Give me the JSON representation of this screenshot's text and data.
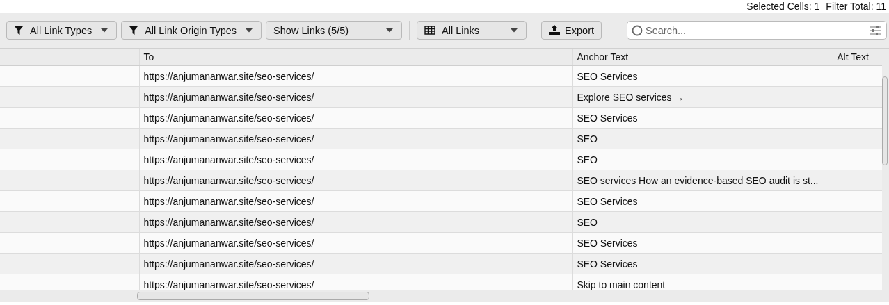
{
  "status_bar": {
    "selected_cells": "Selected Cells: 1",
    "filter_total": "Filter Total: 11"
  },
  "toolbar": {
    "dropdowns": [
      {
        "kind": "filter",
        "label": "All Link Types"
      },
      {
        "kind": "filter",
        "label": "All Link Origin Types"
      },
      {
        "kind": "plain",
        "label": "Show Links (5/5)"
      },
      {
        "kind": "view",
        "label": "All Links"
      }
    ],
    "export_button": "Export",
    "search": {
      "placeholder": "Search..."
    }
  },
  "table": {
    "columns": [
      "To",
      "Anchor Text",
      "Alt Text"
    ],
    "rows": [
      {
        "to": "https://anjumananwar.site/seo-services/",
        "anchor_text": "SEO Services"
      },
      {
        "to": "https://anjumananwar.site/seo-services/",
        "anchor_text": "Explore SEO services →"
      },
      {
        "to": "https://anjumananwar.site/seo-services/",
        "anchor_text": "SEO Services"
      },
      {
        "to": "https://anjumananwar.site/seo-services/",
        "anchor_text": "SEO"
      },
      {
        "to": "https://anjumananwar.site/seo-services/",
        "anchor_text": "SEO"
      },
      {
        "to": "https://anjumananwar.site/seo-services/",
        "anchor_text": "SEO services How an evidence-based SEO audit is st..."
      },
      {
        "to": "https://anjumananwar.site/seo-services/",
        "anchor_text": "SEO Services"
      },
      {
        "to": "https://anjumananwar.site/seo-services/",
        "anchor_text": "SEO"
      },
      {
        "to": "https://anjumananwar.site/seo-services/",
        "anchor_text": "SEO Services"
      },
      {
        "to": "https://anjumananwar.site/seo-services/",
        "anchor_text": "SEO Services"
      },
      {
        "to": "https://anjumananwar.site/seo-services/",
        "anchor_text": "Skip to main content"
      }
    ]
  }
}
